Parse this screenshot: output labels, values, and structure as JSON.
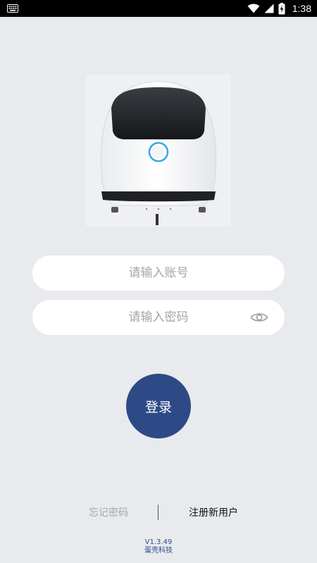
{
  "status_bar": {
    "time": "1:38",
    "icons": [
      "keyboard-icon",
      "wifi-icon",
      "signal-icon",
      "battery-charging-icon"
    ]
  },
  "robot_image": {
    "description_icon": "robot-product-image"
  },
  "login_form": {
    "account_placeholder": "请输入账号",
    "password_placeholder": "请输入密码",
    "account_value": "",
    "password_value": "",
    "toggle_icon": "eye-icon"
  },
  "login_button": {
    "label": "登录"
  },
  "links": {
    "forgot_password": "忘记密码",
    "register": "注册新用户"
  },
  "footer": {
    "version": "V1.3.49",
    "company": "蛋壳科技"
  },
  "colors": {
    "background": "#e8eaee",
    "primary": "#2e4a86",
    "field_bg": "#ffffff",
    "placeholder": "#a5a5a5",
    "muted_link": "#a6a6a6"
  }
}
